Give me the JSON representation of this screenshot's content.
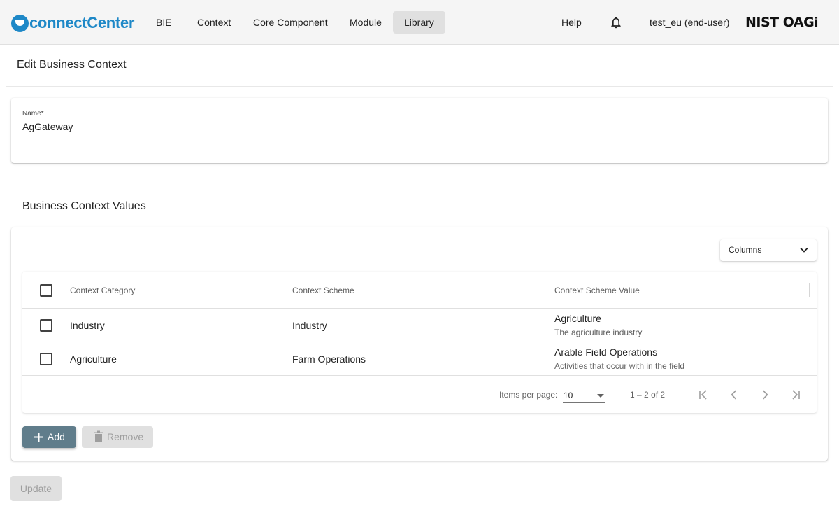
{
  "header": {
    "logo_text": "connectCenter",
    "nav": [
      "BIE",
      "Context",
      "Core Component",
      "Module",
      "Library"
    ],
    "active_nav": "Library",
    "help_label": "Help",
    "user_label": "test_eu (end-user)",
    "partner_logo": "NIST OAGi"
  },
  "page": {
    "title": "Edit Business Context"
  },
  "name_field": {
    "label": "Name*",
    "value": "AgGateway"
  },
  "values_section": {
    "title": "Business Context Values",
    "columns_label": "Columns",
    "headers": [
      "Context Category",
      "Context Scheme",
      "Context Scheme Value"
    ],
    "rows": [
      {
        "category": "Industry",
        "scheme": "Industry",
        "value": "Agriculture",
        "description": "The agriculture industry"
      },
      {
        "category": "Agriculture",
        "scheme": "Farm Operations",
        "value": "Arable Field Operations",
        "description": "Activities that occur with in the field"
      }
    ],
    "paginator": {
      "items_per_page_label": "Items per page:",
      "page_size": "10",
      "range_label": "1 – 2 of 2"
    },
    "add_label": "Add",
    "remove_label": "Remove"
  },
  "update_label": "Update",
  "icons": {
    "notifications": "bell-icon",
    "columns_toggle": "chevron-down-icon",
    "add": "plus-icon",
    "remove": "trash-icon",
    "first_page": "first-page-icon",
    "prev_page": "chevron-left-icon",
    "next_page": "chevron-right-icon",
    "last_page": "last-page-icon"
  },
  "colors": {
    "brand": "#1e88c7",
    "primary_button": "#607d8b",
    "disabled_button": "#e0e0e0"
  }
}
